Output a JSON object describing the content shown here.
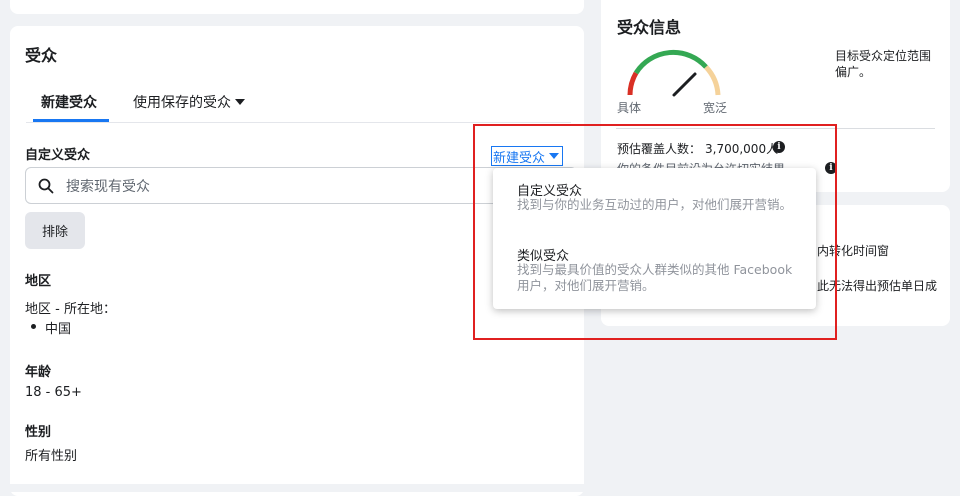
{
  "audience": {
    "title": "受众",
    "tabs": [
      {
        "label": "新建受众",
        "active": true
      },
      {
        "label": "使用保存的受众",
        "active": false
      }
    ],
    "custom_label": "自定义受众",
    "new_audience_btn": "新建受众",
    "search_placeholder": "搜索现有受众",
    "exclude_btn": "排除",
    "location": {
      "heading": "地区",
      "line": "地区 - 所在地：",
      "items": [
        "中国"
      ]
    },
    "age": {
      "heading": "年龄",
      "value": "18 - 65+"
    },
    "gender": {
      "heading": "性别",
      "value": "所有性别"
    }
  },
  "dropdown": {
    "items": [
      {
        "title": "自定义受众",
        "desc": "找到与你的业务互动过的用户，对他们展开营销。"
      },
      {
        "title": "类似受众",
        "desc": "找到与最具价值的受众人群类似的其他 Facebook 用户，对他们展开营销。"
      }
    ]
  },
  "info": {
    "title": "受众信息",
    "gauge_left": "具体",
    "gauge_right": "宽泛",
    "gauge_desc": "目标受众定位范围偏广。",
    "reach_label": "预估覆盖人数：",
    "reach_value": "3,700,000人",
    "reach_note_partial": "你的条件目前设为允许切实结果"
  },
  "estimate": {
    "line1": "内转化时间窗",
    "line2": "此无法得出预估单日成"
  },
  "colors": {
    "accent": "#1877f2",
    "highlight": "#e02020"
  }
}
